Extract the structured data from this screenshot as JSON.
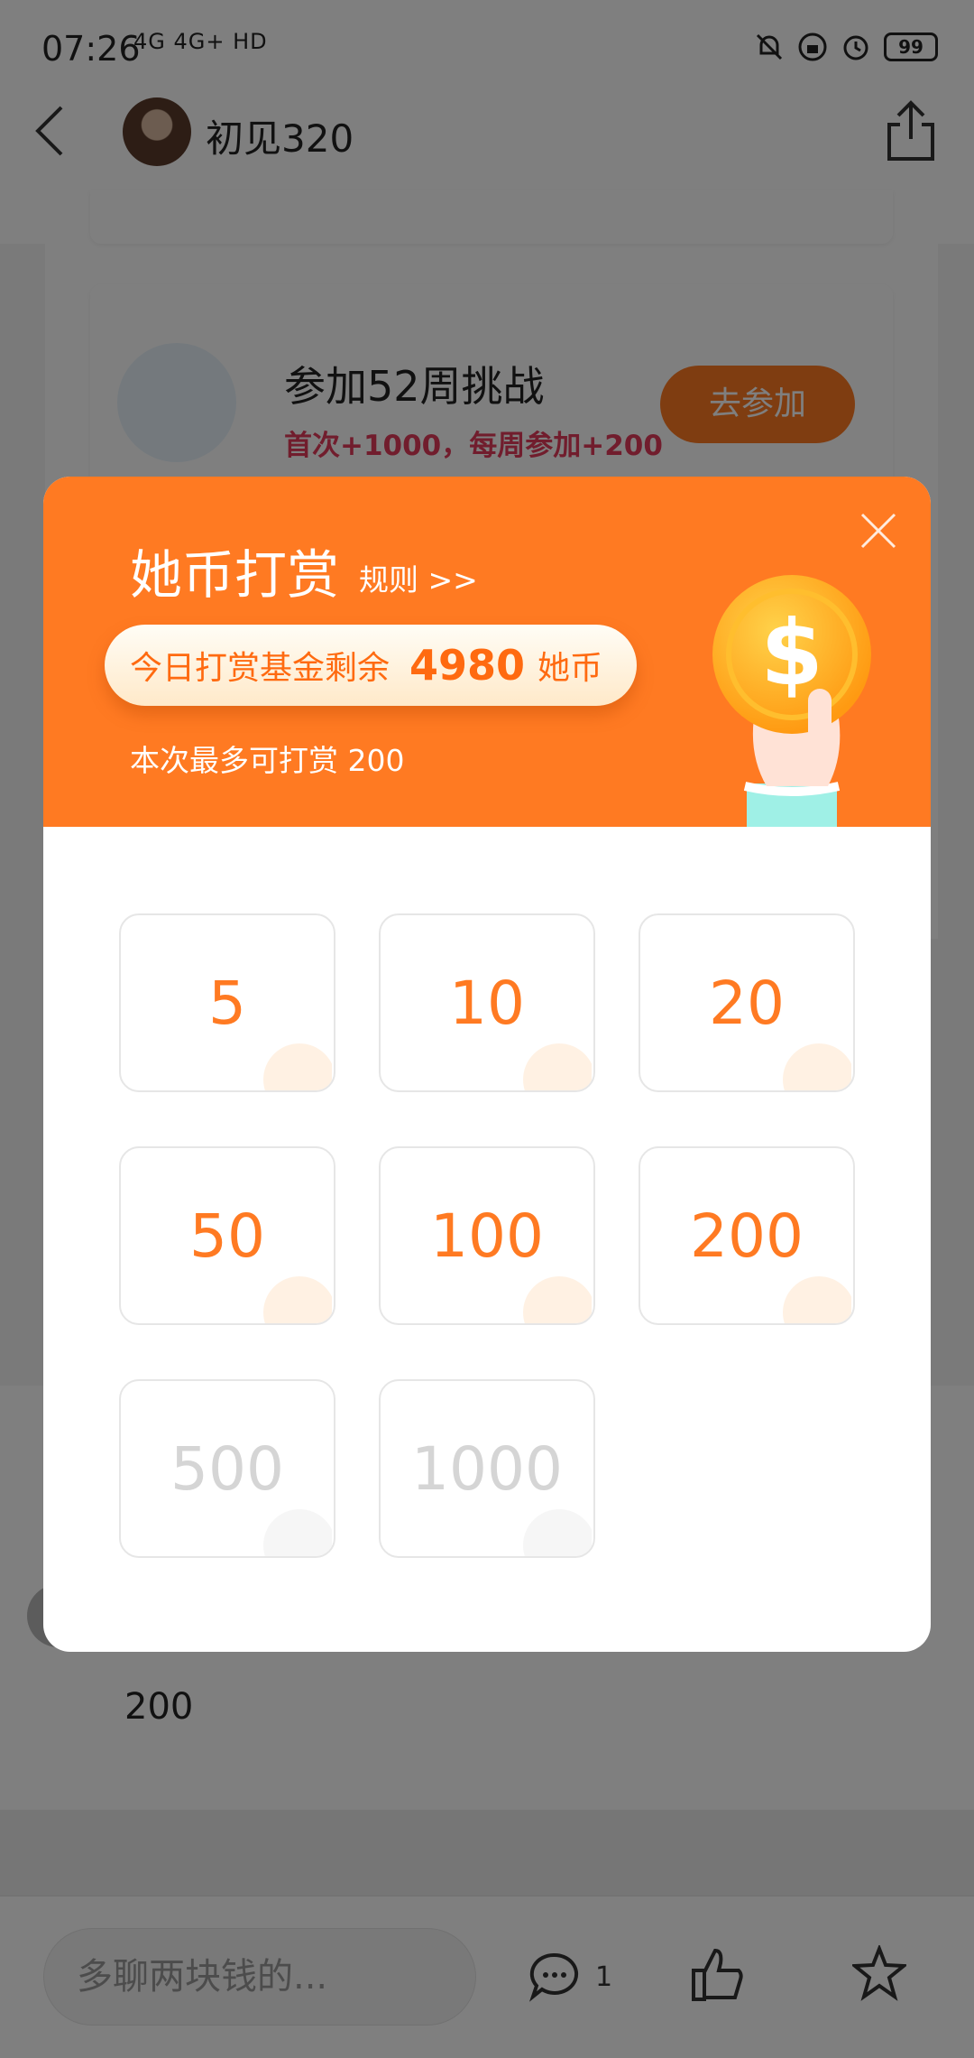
{
  "status_bar": {
    "time": "07:26",
    "network": "4G  4G+ HD",
    "battery": "99"
  },
  "header": {
    "user_name": "初见320"
  },
  "task_card": {
    "title": "参加52周挑战",
    "subtitle": "首次+1000，每周参加+200",
    "button_label": "去参加"
  },
  "comment": {
    "text": "200"
  },
  "bottom_bar": {
    "input_placeholder": "多聊两块钱的...",
    "comment_count": "1"
  },
  "modal": {
    "title": "她币打赏",
    "rules_link": "规则 >>",
    "fund_label": "今日打赏基金剩余",
    "fund_value": "4980",
    "fund_unit": "她币",
    "max_note": "本次最多可打赏 200",
    "amounts": [
      {
        "label": "5",
        "enabled": true
      },
      {
        "label": "10",
        "enabled": true
      },
      {
        "label": "20",
        "enabled": true
      },
      {
        "label": "50",
        "enabled": true
      },
      {
        "label": "100",
        "enabled": true
      },
      {
        "label": "200",
        "enabled": true
      },
      {
        "label": "500",
        "enabled": false
      },
      {
        "label": "1000",
        "enabled": false
      }
    ]
  },
  "colors": {
    "accent": "#ff7a22",
    "task_subtitle": "#e23b5a",
    "disabled_text": "#d5d5d5",
    "overlay": "rgba(0,0,0,0.5)"
  }
}
